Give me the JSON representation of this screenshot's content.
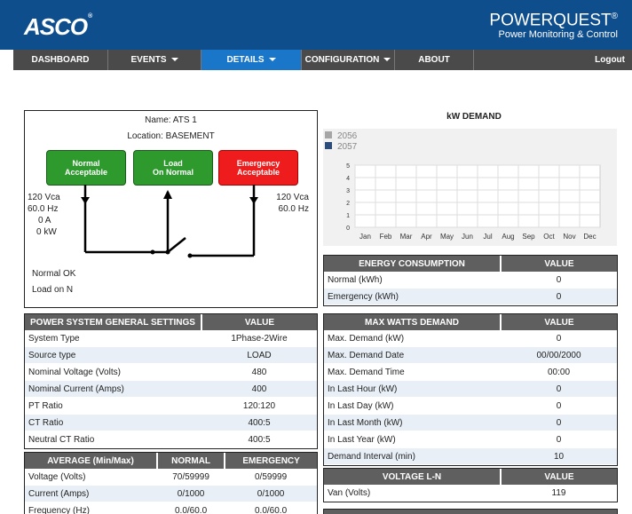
{
  "header": {
    "brand": "ASCO",
    "brand_mark": "®",
    "product_title": "POWERQUEST",
    "product_mark": "®",
    "product_subtitle": "Power Monitoring & Control"
  },
  "nav": {
    "items": [
      {
        "label": "DASHBOARD"
      },
      {
        "label": "EVENTS"
      },
      {
        "label": "DETAILS"
      },
      {
        "label": "CONFIGURATION"
      },
      {
        "label": "ABOUT"
      }
    ],
    "logout": "Logout",
    "active": "DETAILS"
  },
  "ats": {
    "name": "Name: ATS 1",
    "location": "Location: BASEMENT",
    "box_normal": {
      "line1": "Normal",
      "line2": "Acceptable",
      "color": "#2e9a2e"
    },
    "box_load": {
      "line1": "Load",
      "line2": "On Normal",
      "color": "#2e9a2e"
    },
    "box_emergency": {
      "line1": "Emergency",
      "line2": "Acceptable",
      "color": "#ee1c1c"
    },
    "normal_voltage": "120 Vca",
    "normal_freq": "60.0 Hz",
    "normal_current": "0 A",
    "normal_power": "0 kW",
    "emerg_voltage": "120 Vca",
    "emerg_freq": "60.0 Hz",
    "status1": "Normal OK",
    "status2": "Load on N"
  },
  "kw_demand": {
    "title": "kW DEMAND",
    "legend": [
      {
        "name": "2056",
        "color": "#a6a6a6"
      },
      {
        "name": "2057",
        "color": "#2c4d7a"
      }
    ]
  },
  "chart_data": {
    "type": "bar",
    "title": "kW DEMAND",
    "categories": [
      "Jan",
      "Feb",
      "Mar",
      "Apr",
      "May",
      "Jun",
      "Jul",
      "Aug",
      "Sep",
      "Oct",
      "Nov",
      "Dec"
    ],
    "series": [
      {
        "name": "2056",
        "values": [
          0,
          0,
          0,
          0,
          0,
          0,
          0,
          0,
          0,
          0,
          0,
          0
        ]
      },
      {
        "name": "2057",
        "values": [
          0,
          0,
          0,
          0,
          0,
          0,
          0,
          0,
          0,
          0,
          0,
          0
        ]
      }
    ],
    "y_ticks": [
      "0",
      "1",
      "2",
      "3",
      "4",
      "5"
    ],
    "ylim": [
      0,
      5
    ],
    "grid": true,
    "legend_position": "top-left"
  },
  "energy": {
    "headers": [
      "ENERGY CONSUMPTION",
      "VALUE"
    ],
    "rows": [
      {
        "label": "Normal (kWh)",
        "value": "0"
      },
      {
        "label": "Emergency (kWh)",
        "value": "0"
      }
    ]
  },
  "power_settings": {
    "headers": [
      "POWER SYSTEM GENERAL SETTINGS",
      "VALUE"
    ],
    "rows": [
      {
        "label": "System Type",
        "value": "1Phase-2Wire"
      },
      {
        "label": "Source type",
        "value": "LOAD"
      },
      {
        "label": "Nominal Voltage (Volts)",
        "value": "480"
      },
      {
        "label": "Nominal Current (Amps)",
        "value": "400"
      },
      {
        "label": "PT Ratio",
        "value": "120:120"
      },
      {
        "label": "CT Ratio",
        "value": "400:5"
      },
      {
        "label": "Neutral CT Ratio",
        "value": "400:5"
      }
    ]
  },
  "max_watts": {
    "headers": [
      "MAX WATTS DEMAND",
      "VALUE"
    ],
    "rows": [
      {
        "label": "Max. Demand (kW)",
        "value": "0"
      },
      {
        "label": "Max. Demand Date",
        "value": "00/00/2000"
      },
      {
        "label": "Max. Demand Time",
        "value": "00:00"
      },
      {
        "label": "In Last Hour (kW)",
        "value": "0"
      },
      {
        "label": "In Last Day (kW)",
        "value": "0"
      },
      {
        "label": "In Last Month (kW)",
        "value": "0"
      },
      {
        "label": "In Last Year (kW)",
        "value": "0"
      },
      {
        "label": "Demand Interval (min)",
        "value": "10"
      }
    ]
  },
  "average": {
    "headers": [
      "AVERAGE (Min/Max)",
      "NORMAL",
      "EMERGENCY"
    ],
    "rows": [
      {
        "label": "Voltage (Volts)",
        "normal": "70/59999",
        "emergency": "0/59999"
      },
      {
        "label": "Current (Amps)",
        "normal": "0/1000",
        "emergency": "0/1000"
      },
      {
        "label": "Frequency (Hz)",
        "normal": "0.0/60.0",
        "emergency": "0.0/60.0"
      }
    ]
  },
  "voltage_ln": {
    "headers": [
      "VOLTAGE L-N",
      "VALUE"
    ],
    "rows": [
      {
        "label": "Van (Volts)",
        "value": "119"
      }
    ]
  }
}
